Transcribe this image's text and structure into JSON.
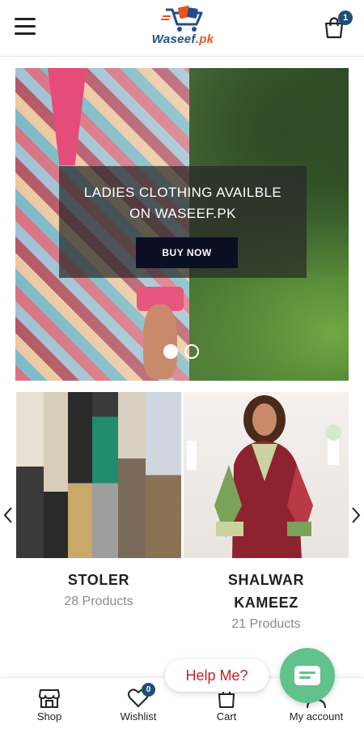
{
  "header": {
    "logo_text_main": "Waseef",
    "logo_text_suffix": ".pk",
    "cart_count": "1"
  },
  "hero": {
    "title_line1": "LADIES CLOTHING AVAILBLE",
    "title_line2": "ON WASEEF.PK",
    "button_label": "BUY NOW",
    "slides": 2,
    "active_slide": 1
  },
  "categories": [
    {
      "name": "STOLER",
      "count": "28 Products"
    },
    {
      "name_line1": "SHALWAR",
      "name_line2": "KAMEEZ",
      "count": "21 Products"
    }
  ],
  "help": {
    "label": "Help Me?"
  },
  "bottom_nav": {
    "shop": "Shop",
    "wishlist": "Wishlist",
    "wishlist_count": "0",
    "cart": "Cart",
    "account": "My account"
  },
  "colors": {
    "brand_blue": "#1f4e8c",
    "brand_orange": "#e8541f",
    "badge": "#1f4e79",
    "help_text": "#c91f24",
    "chat_green": "#62c28e"
  }
}
